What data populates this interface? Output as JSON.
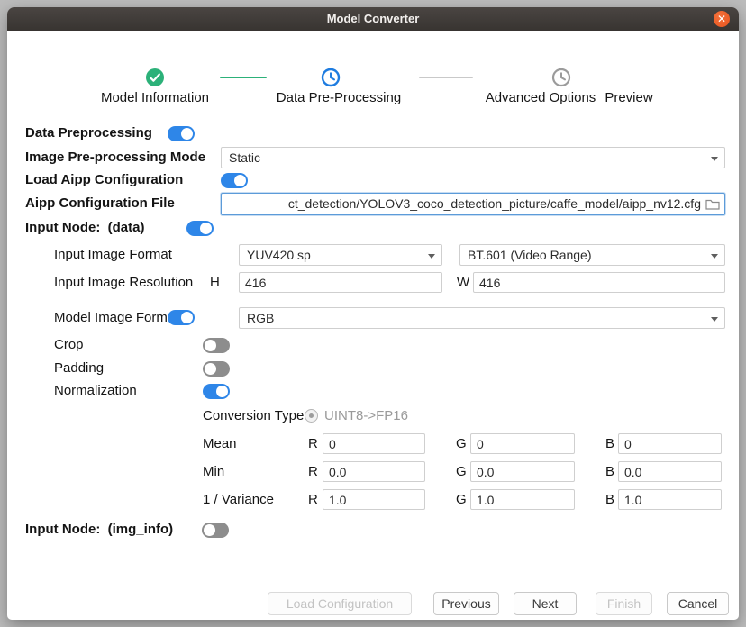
{
  "window": {
    "title": "Model Converter",
    "close_glyph": "✕"
  },
  "stepper": {
    "steps": [
      {
        "label": "Model Information",
        "state": "done"
      },
      {
        "label": "Data Pre-Processing",
        "state": "active"
      },
      {
        "label": "Advanced Options",
        "state": "pending"
      },
      {
        "label": "Preview",
        "state": "pending"
      }
    ]
  },
  "colors": {
    "accent_blue": "#2e86e8",
    "done_green": "#2cb179",
    "pending_gray": "#9b9b9b"
  },
  "form": {
    "data_preprocessing_label": "Data Preprocessing",
    "image_mode_label": "Image Pre-processing Mode",
    "image_mode_value": "Static",
    "load_aipp_label": "Load Aipp Configuration",
    "aipp_file_label": "Aipp Configuration File",
    "aipp_file_value": "ct_detection/YOLOV3_coco_detection_picture/caffe_model/aipp_nv12.cfg",
    "input_node_data_label": "Input Node:  (data)",
    "input_image_format_label": "Input Image Format",
    "input_image_format_value": "YUV420 sp",
    "color_range_value": "BT.601 (Video Range)",
    "input_image_resolution_label": "Input Image Resolution",
    "h_label": "H",
    "h_value": "416",
    "w_label": "W",
    "w_value": "416",
    "model_image_format_label": "Model Image Format",
    "model_image_format_value": "RGB",
    "crop_label": "Crop",
    "padding_label": "Padding",
    "normalization_label": "Normalization",
    "conversion_type_label": "Conversion Type",
    "conversion_type_value": "UINT8->FP16",
    "channel_labels": {
      "r": "R",
      "g": "G",
      "b": "B"
    },
    "rgb_rows": [
      {
        "label": "Mean",
        "r": "0",
        "g": "0",
        "b": "0"
      },
      {
        "label": "Min",
        "r": "0.0",
        "g": "0.0",
        "b": "0.0"
      },
      {
        "label": "1 / Variance",
        "r": "1.0",
        "g": "1.0",
        "b": "1.0"
      }
    ],
    "input_node_imginfo_label": "Input Node:  (img_info)"
  },
  "footer": {
    "load_configuration": "Load Configuration",
    "previous": "Previous",
    "next": "Next",
    "finish": "Finish",
    "cancel": "Cancel"
  }
}
